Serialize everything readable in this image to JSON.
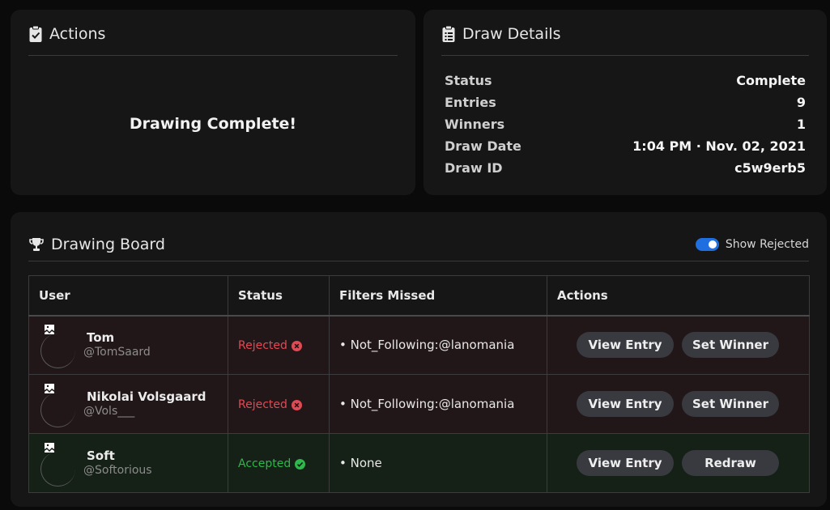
{
  "actions": {
    "title": "Actions",
    "icon": "clipboard-check-icon",
    "message": "Drawing Complete!"
  },
  "details": {
    "title": "Draw Details",
    "icon": "clipboard-list-icon",
    "rows": [
      {
        "label": "Status",
        "value": "Complete"
      },
      {
        "label": "Entries",
        "value": "9"
      },
      {
        "label": "Winners",
        "value": "1"
      },
      {
        "label": "Draw Date",
        "value": "1:04 PM · Nov. 02, 2021"
      },
      {
        "label": "Draw ID",
        "value": "c5w9erb5"
      }
    ]
  },
  "board": {
    "title": "Drawing Board",
    "icon": "trophy-icon",
    "toggle_label": "Show Rejected",
    "toggle_on": true,
    "columns": [
      "User",
      "Status",
      "Filters Missed",
      "Actions"
    ],
    "rows": [
      {
        "name": "Tom",
        "handle": "@TomSaard",
        "status": "Rejected",
        "status_icon": "x-circle-icon",
        "filters": "• Not_Following:@lanomania",
        "primary_action": "View Entry",
        "secondary_action": "Set Winner"
      },
      {
        "name": "Nikolai Volsgaard",
        "handle": "@Vols___",
        "status": "Rejected",
        "status_icon": "x-circle-icon",
        "filters": "• Not_Following:@lanomania",
        "primary_action": "View Entry",
        "secondary_action": "Set Winner"
      },
      {
        "name": "Soft",
        "handle": "@Softorious",
        "status": "Accepted",
        "status_icon": "check-circle-icon",
        "filters": "• None",
        "primary_action": "View Entry",
        "secondary_action": "Redraw"
      }
    ]
  },
  "colors": {
    "background": "#0a0a0a",
    "card": "#161617",
    "accent": "#1f6fe0",
    "rejected": "#e04a55",
    "accepted": "#2fb64c",
    "rejected_row": "#221718",
    "accepted_row": "#152016"
  }
}
